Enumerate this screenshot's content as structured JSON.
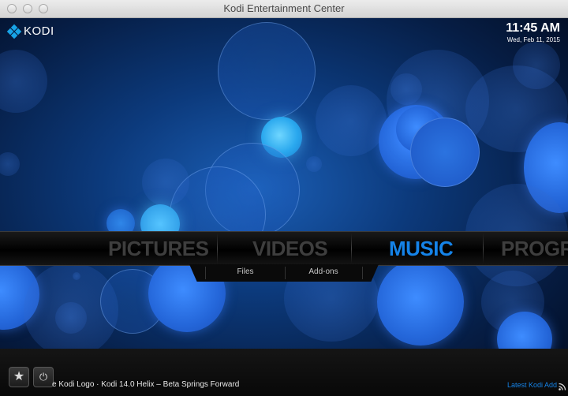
{
  "window": {
    "title": "Kodi Entertainment Center"
  },
  "logo": {
    "text": "KODI"
  },
  "clock": {
    "time": "11:45 AM",
    "date": "Wed, Feb 11, 2015"
  },
  "menu": {
    "items": [
      {
        "label": "PICTURES",
        "active": false
      },
      {
        "label": "VIDEOS",
        "active": false
      },
      {
        "label": "MUSIC",
        "active": true
      },
      {
        "label": "PROGRA",
        "active": false
      }
    ],
    "submenu": [
      {
        "label": "Files"
      },
      {
        "label": "Add-ons"
      }
    ]
  },
  "footer": {
    "ticker": "e Kodi Logo · Kodi 14.0 Helix – Beta Springs Forward",
    "latest": "Latest Kodi Add",
    "buttons": [
      {
        "icon": "star-icon",
        "glyph": "★"
      },
      {
        "icon": "power-icon",
        "glyph": "⏻"
      }
    ]
  },
  "colors": {
    "accent": "#1583e8",
    "menu_inactive": "#3e3e3e"
  }
}
